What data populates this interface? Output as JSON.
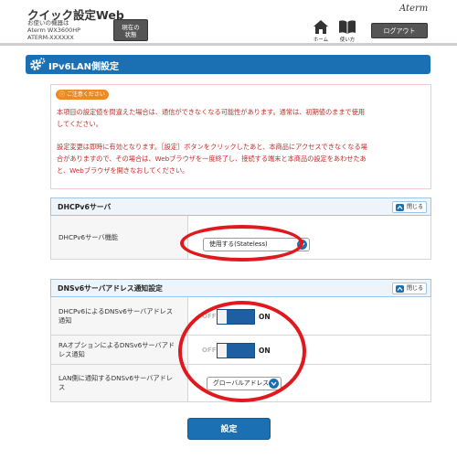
{
  "header": {
    "app_title": "クイック設定Web",
    "device_caption": "お使いの機器は",
    "device_model": "Aterm WX3600HP",
    "device_id": "ATERM-XXXXXX",
    "status_button_line1": "現在の",
    "status_button_line2": "状態",
    "brand": "Aterm",
    "home_label": "ホーム",
    "help_label": "使い方",
    "logout_label": "ログアウト"
  },
  "page": {
    "title": "IPv6LAN側設定"
  },
  "caution": {
    "badge": "ご注意ください",
    "line1": "本項目の設定値を間違えた場合は、通信ができなくなる可能性があります。通常は、初期値のままで使用",
    "line2": "してください。",
    "line3": "設定変更は即時に有効となります。［設定］ボタンをクリックしたあと、本商品にアクセスできなくなる場",
    "line4": "合がありますので、その場合は、Webブラウザを一度終了し、接続する端末と本商品の設定をあわせたあ",
    "line5": "と、Webブラウザを開きなおしてください。"
  },
  "dhcpv6_section": {
    "title": "DHCPv6サーバ",
    "close_label": "閉じる",
    "rows": [
      {
        "label": "DHCPv6サーバ機能",
        "value": "使用する(Stateless)"
      }
    ]
  },
  "dnsv6_section": {
    "title": "DNSv6サーバアドレス通知設定",
    "close_label": "閉じる",
    "rows": [
      {
        "label_line1": "DHCPv6によるDNSv6サーバアドレス",
        "label_line2": "通知",
        "off_label": "OFF",
        "on_label": "ON",
        "state": "ON"
      },
      {
        "label_line1": "RAオプションによるDNSv6サーバアド",
        "label_line2": "レス通知",
        "off_label": "OFF",
        "on_label": "ON",
        "state": "ON"
      },
      {
        "label_line1": "LAN側に通知するDNSv6サーバアドレ",
        "label_line2": "ス",
        "value": "グローバルアドレス"
      }
    ]
  },
  "actions": {
    "apply_label": "設定"
  },
  "colors": {
    "accent": "#1b6fb3",
    "warning_text": "#c32a2a",
    "badge": "#ee8a22",
    "highlight_ring": "#e0191e"
  }
}
